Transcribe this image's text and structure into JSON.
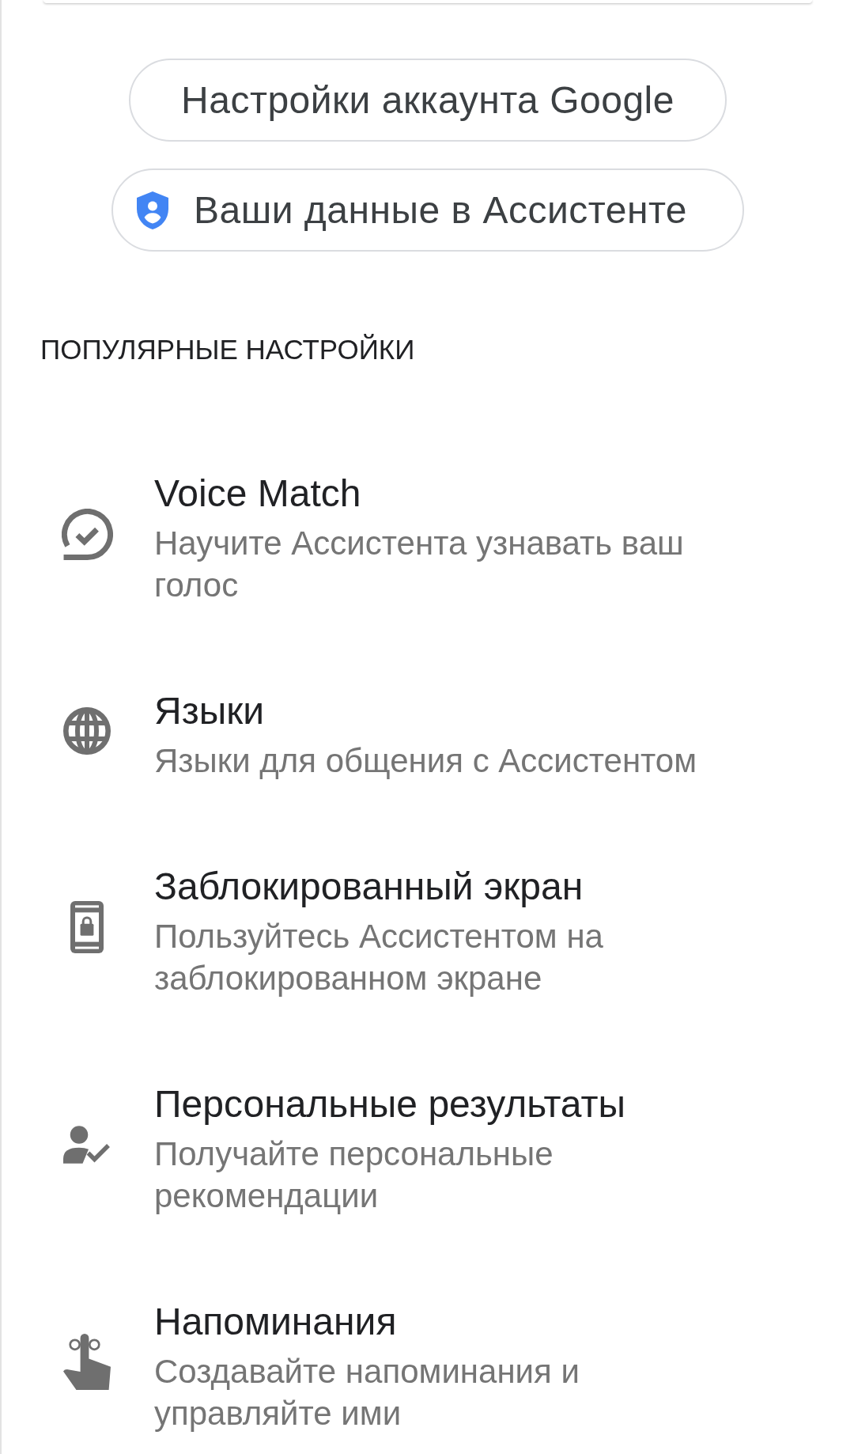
{
  "buttons": [
    {
      "label": "Настройки аккаунта Google",
      "kind": "plain"
    },
    {
      "label": "Ваши данные в Ассистенте",
      "kind": "shield"
    }
  ],
  "section": {
    "title": "ПОПУЛЯРНЫЕ НАСТРОЙКИ",
    "items": [
      {
        "kind": "voice",
        "title": "Voice Match",
        "subtitle": "Научите Ассистента узнавать ваш голос"
      },
      {
        "kind": "language",
        "title": "Языки",
        "subtitle": "Языки для общения с Ассистентом"
      },
      {
        "kind": "lockscreen",
        "title": "Заблокированный экран",
        "subtitle": "Пользуйтесь Ассистентом на заблокированном экране"
      },
      {
        "kind": "personal",
        "title": "Персональные результаты",
        "subtitle": "Получайте персональные рекомендации"
      },
      {
        "kind": "reminder",
        "title": "Напоминания",
        "subtitle": "Создавайте напоминания и управляйте ими"
      }
    ]
  }
}
